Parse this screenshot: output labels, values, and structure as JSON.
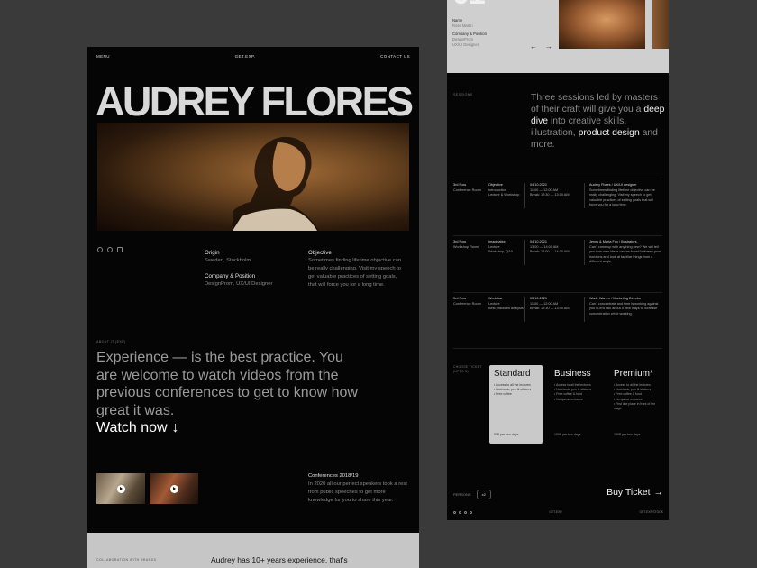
{
  "left": {
    "nav": {
      "menu": "MENU",
      "center": "GET.EXP.",
      "contact": "CONTACT US"
    },
    "hero_name": "AUDREY FLORES",
    "socials": [
      "facebook-icon",
      "dribbble-icon",
      "behance-icon"
    ],
    "origin": {
      "label": "Origin",
      "value": "Sweden, Stockholm"
    },
    "company": {
      "label": "Company & Position",
      "value": "DesignProm, UX/UI Designer"
    },
    "objective": {
      "label": "Objective",
      "value": "Sometimes finding lifetime objective can be really challenging. Visit my speech to get valuable practices of setting goals, that will force you for a long time."
    },
    "about_caption": "ABOUT IT (EXP)",
    "experience": "Experience — is the best practice. You are welcome to watch videos from the previous conferences to get to know how great it was.",
    "watch_now": "Watch now",
    "conference": {
      "label": "Conferences 2018/19",
      "value": "In 2020 all our perfect speakers took a rest from public speeches to get more knowledge for you to share this year."
    },
    "collab_caption": "COLLABORATION WITH BRANDS",
    "collab_quote": "Audrey has 10+ years experience, that's"
  },
  "right_top": {
    "big_number": "01",
    "name": {
      "label": "Name",
      "value": "Rose Martin"
    },
    "company": {
      "label": "Company & Position",
      "value": "DesignProm",
      "value2": "UX/UI Designer"
    },
    "prev": "←",
    "next": "→"
  },
  "right": {
    "sessions_caption": "SESSIONS",
    "sessions": {
      "p1": "Three sessions led by masters of their craft will give you a ",
      "h1": "deep dive",
      "p2": " into creative skills, illustration, ",
      "h2": "product design",
      "p3": " and more."
    },
    "schedule": [
      {
        "tag": "3rd Row",
        "room": "Conference Room",
        "topic_label": "Objective",
        "topic_lines": [
          "Introduction",
          "Lecture & Workshop"
        ],
        "date": "04.10.2021",
        "time1": "11:00 — 12:00 AM",
        "time2": "Break: 12:30 — 13:00 AM",
        "speaker": "Audrey Flores / UX/UI designer",
        "desc": "Sometimes finding lifetime objective can be really challenging. Visit my speech to get valuable practices of setting goals that will force you for a long time."
      },
      {
        "tag": "3rd Row",
        "room": "Workshop Room",
        "topic_label": "Imagination",
        "topic_lines": [
          "Lecture",
          "Workshop, Q&A"
        ],
        "date": "04.10.2021",
        "time1": "13:00 — 14:00 AM",
        "time2": "Break: 14:00 — 14:30 AM",
        "speaker": "Jenny & Marta Fox / Illustrators",
        "desc": "Can't come up with anything new? We will tell you how new ideas can be found between your horizons and look at familiar things from a different angle."
      },
      {
        "tag": "3rd Row",
        "room": "Conference Room",
        "topic_label": "Workflow",
        "topic_lines": [
          "Lecture",
          "Best practices analysis"
        ],
        "date": "05.10.2021",
        "time1": "11:00 — 12:00 AM",
        "time2": "Break: 12:30 — 13:00 AM",
        "speaker": "Wade Warren / Marketing Director",
        "desc": "Can't concentrate and time is working against you? Let's talk about 5 new ways to increase concentration while working."
      }
    ],
    "tickets_caption": [
      "CHOOSE TICKET",
      "(UPTO 5)"
    ],
    "tickets": [
      {
        "name": "Standard",
        "features": [
          "Access to all the lectures",
          "Notebook, pen & stickers",
          "Free coffee"
        ],
        "price": "50$ per two days"
      },
      {
        "name": "Business",
        "features": [
          "Access to all the lectures",
          "Notebook, pen & stickers",
          "Free coffee & food",
          "No queue entrance"
        ],
        "price": "100$ per two days"
      },
      {
        "name": "Premium",
        "features": [
          "Access to all the lectures",
          "Notebook, pen & stickers",
          "Free coffee & food",
          "No queue entrance",
          "First line place in front of the stage"
        ],
        "price": "150$ per two days"
      }
    ],
    "persons_label": "PERSONS",
    "persons_value": "x2",
    "buy_ticket": "Buy Ticket",
    "footer": {
      "center": "GET.EXP.",
      "right": "GET.EXP.STOCK"
    }
  }
}
